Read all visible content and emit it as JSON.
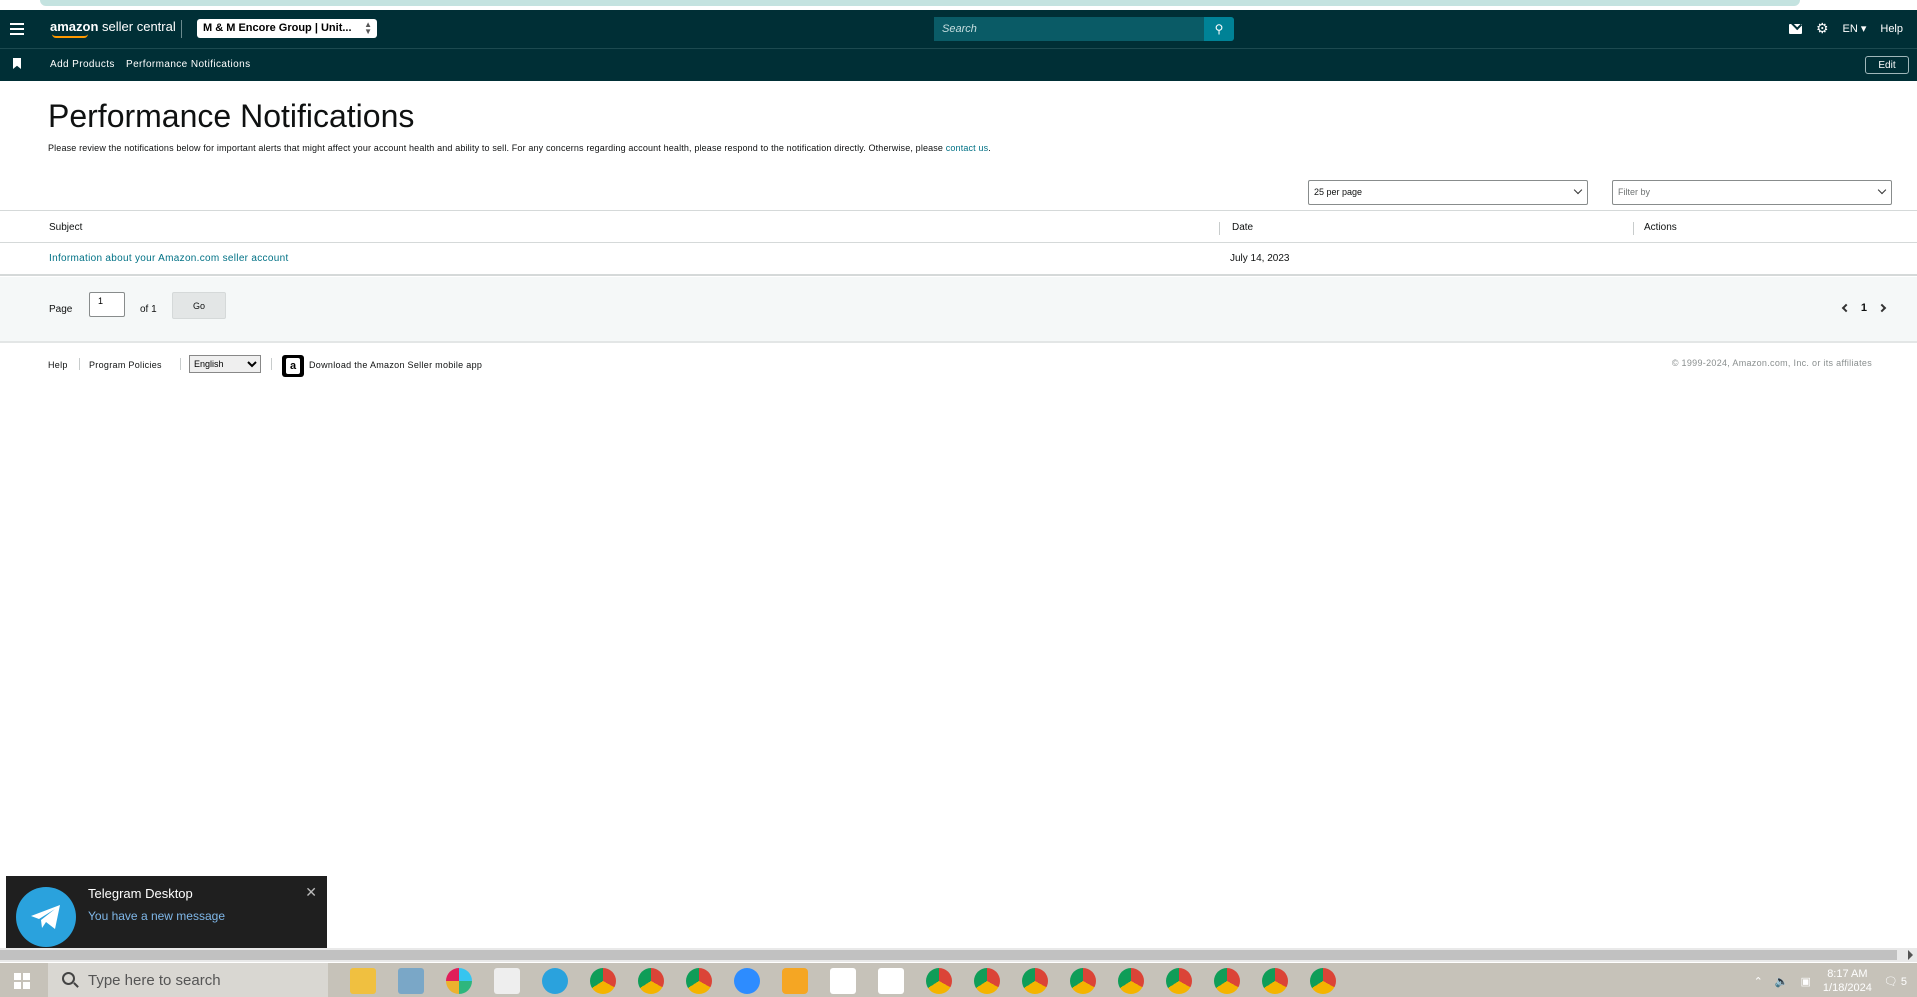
{
  "header": {
    "logo_brand": "amazon",
    "logo_suffix": "seller central",
    "account": "M & M Encore Group | Unit...",
    "search_placeholder": "Search",
    "lang": "EN",
    "help": "Help"
  },
  "subnav": {
    "links": [
      "Add Products",
      "Performance Notifications"
    ],
    "edit": "Edit"
  },
  "page": {
    "title": "Performance Notifications",
    "description": "Please review the notifications below for important alerts that might affect your account health and ability to sell. For any concerns regarding account health, please respond to the notification directly. Otherwise, please",
    "contact_link": "contact us",
    "per_page": "25 per page",
    "filter": "Filter by"
  },
  "table": {
    "headers": [
      "Subject",
      "Date",
      "Actions"
    ],
    "rows": [
      {
        "subject": "Information about your Amazon.com seller account",
        "date": "July 14, 2023"
      }
    ]
  },
  "pager": {
    "label": "Page",
    "page_value": "1",
    "of": "of 1",
    "go": "Go",
    "current": "1"
  },
  "footer": {
    "help": "Help",
    "policies": "Program Policies",
    "language": "English",
    "app_text": "Download the Amazon Seller mobile app",
    "copyright": "© 1999-2024, Amazon.com, Inc. or its affiliates"
  },
  "toast": {
    "title": "Telegram Desktop",
    "message": "You have a new message"
  },
  "taskbar": {
    "search_placeholder": "Type here to search",
    "time": "8:17 AM",
    "date": "1/18/2024",
    "notif_count": "5"
  },
  "colors": {
    "nav_bg": "#002f36",
    "link": "#007185",
    "search_btn": "#008296"
  }
}
